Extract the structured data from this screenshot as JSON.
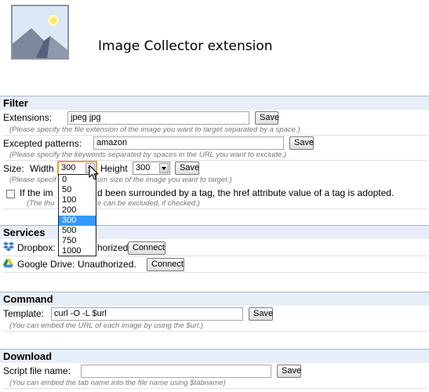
{
  "header": {
    "title": "Image Collector extension"
  },
  "filter": {
    "heading": "Filter",
    "extensions": {
      "label": "Extensions:",
      "value": "jpeg jpg",
      "save": "Save",
      "hint": "(Please specify the file extension of the image you want to target separated by a space.)"
    },
    "excepted": {
      "label": "Excepted patterns:",
      "value": "amazon",
      "save": "Save",
      "hint": "(Please specify the keywords separated by spaces in the URL you want to exclude.)"
    },
    "size": {
      "label": "Size:",
      "width_label": "Width",
      "width_value": "300",
      "height_label": "Height",
      "height_value": "300",
      "save": "Save",
      "hint_start": "(Please specif",
      "hint_end": "um size of the image you want to target.)"
    },
    "width_options": [
      "0",
      "50",
      "100",
      "200",
      "300",
      "500",
      "750",
      "1000"
    ],
    "width_selected": "300",
    "href": {
      "text_start": "If the im",
      "text_end": "d been surrounded by a tag, the href attribute value of a tag is adopted.",
      "hint_start": "(The thu",
      "hint_end": "e can be excluded, if checked.)",
      "checked": false
    }
  },
  "services": {
    "heading": "Services",
    "dropbox": {
      "label": "Dropbox:",
      "status": "horized.",
      "button": "Connect"
    },
    "gdrive": {
      "label": "Google Drive:",
      "status": "Unauthorized.",
      "button": "Connect"
    }
  },
  "command": {
    "heading": "Command",
    "template_label": "Template:",
    "template_value": "curl -O -L $url",
    "save": "Save",
    "hint": "(You can embed the URL of each image by using the $url.)"
  },
  "download": {
    "heading": "Download",
    "script_label": "Script file name:",
    "script_value": "",
    "save": "Save",
    "hint": "(You can embed the tab name into the file name using $tabname)"
  },
  "colors": {
    "section_bg": "#e8eef7",
    "section_border": "#9fb5d3",
    "selected": "#3399ff",
    "focus": "#e9a33a"
  },
  "icons": {
    "logo": "image-icon",
    "dropbox": "dropbox-icon",
    "gdrive": "google-drive-icon",
    "checkbox": "checkbox",
    "cursor": "mouse-pointer-icon"
  }
}
